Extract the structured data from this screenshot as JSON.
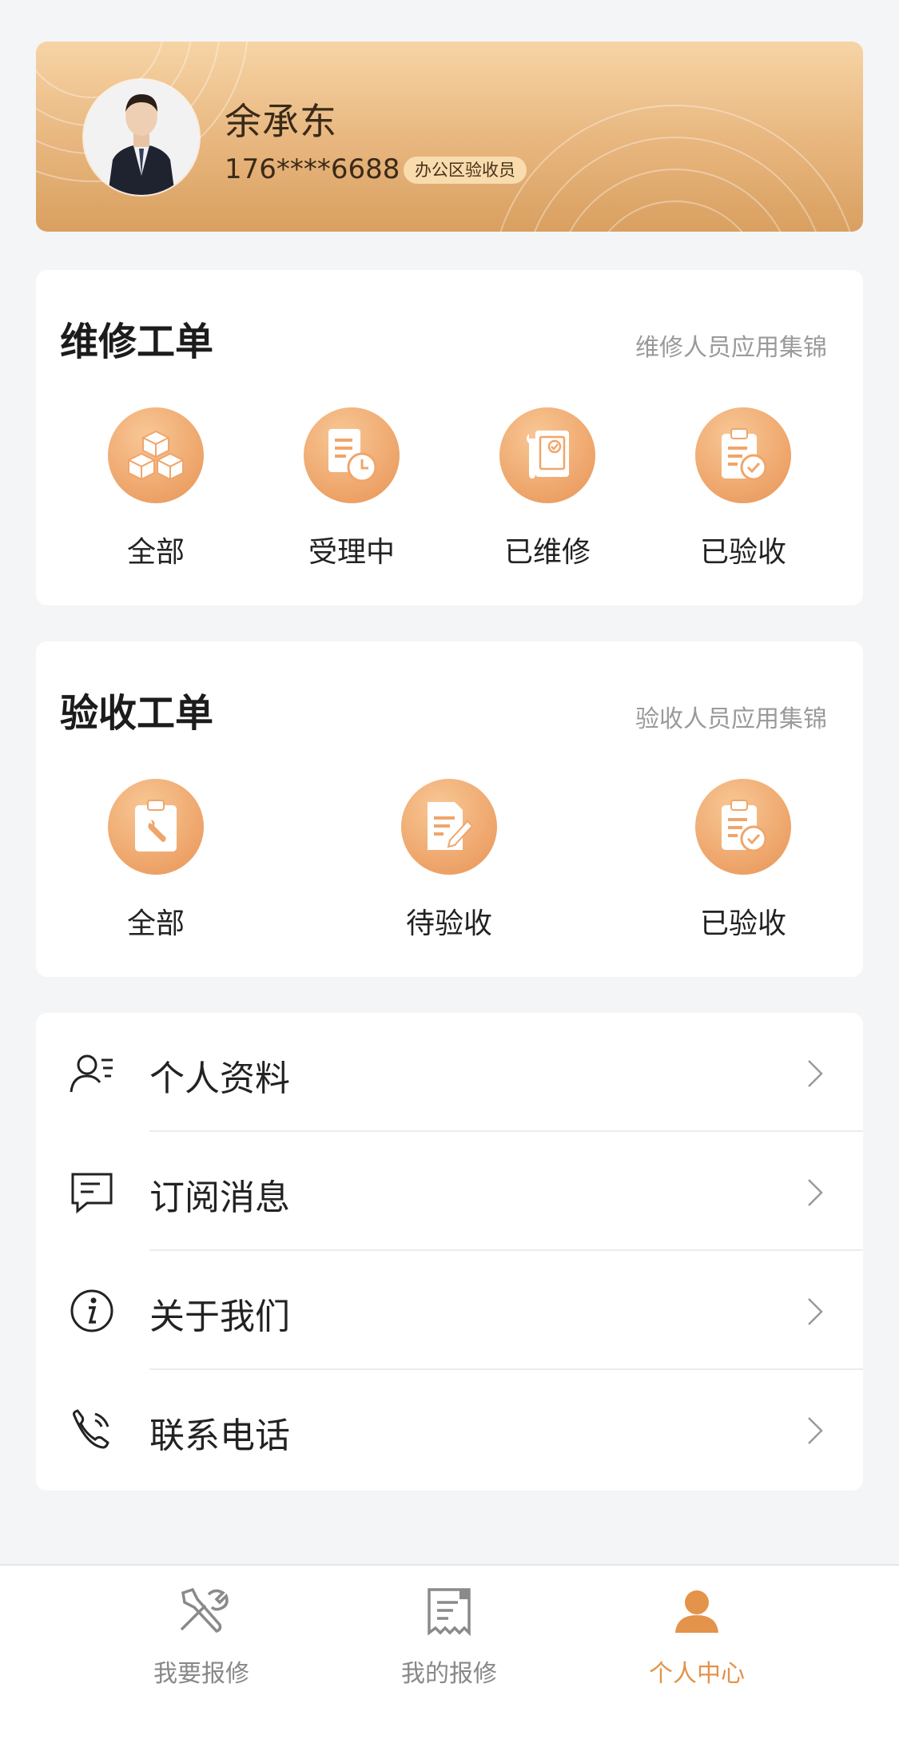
{
  "profile": {
    "name": "余承东",
    "phone": "176****6688",
    "role": "办公区验收员"
  },
  "repair_orders": {
    "title": "维修工单",
    "subtitle": "维修人员应用集锦",
    "items": [
      {
        "label": "全部",
        "icon": "boxes-icon"
      },
      {
        "label": "受理中",
        "icon": "document-clock-icon"
      },
      {
        "label": "已维修",
        "icon": "wrench-document-icon"
      },
      {
        "label": "已验收",
        "icon": "clipboard-check-icon"
      }
    ]
  },
  "acceptance_orders": {
    "title": "验收工单",
    "subtitle": "验收人员应用集锦",
    "items": [
      {
        "label": "全部",
        "icon": "clipboard-wrench-icon"
      },
      {
        "label": "待验收",
        "icon": "document-pen-icon"
      },
      {
        "label": "已验收",
        "icon": "clipboard-check-icon"
      }
    ]
  },
  "menu": [
    {
      "label": "个人资料",
      "icon": "user-profile-icon"
    },
    {
      "label": "订阅消息",
      "icon": "message-icon"
    },
    {
      "label": "关于我们",
      "icon": "info-icon"
    },
    {
      "label": "联系电话",
      "icon": "phone-icon"
    }
  ],
  "tabbar": [
    {
      "label": "我要报修",
      "icon": "tools-icon",
      "active": false
    },
    {
      "label": "我的报修",
      "icon": "receipt-icon",
      "active": false
    },
    {
      "label": "个人中心",
      "icon": "person-icon",
      "active": true
    }
  ],
  "colors": {
    "accent": "#e3934a",
    "card_gradient_top": "#f7d4a5",
    "card_gradient_bottom": "#d9a060"
  }
}
